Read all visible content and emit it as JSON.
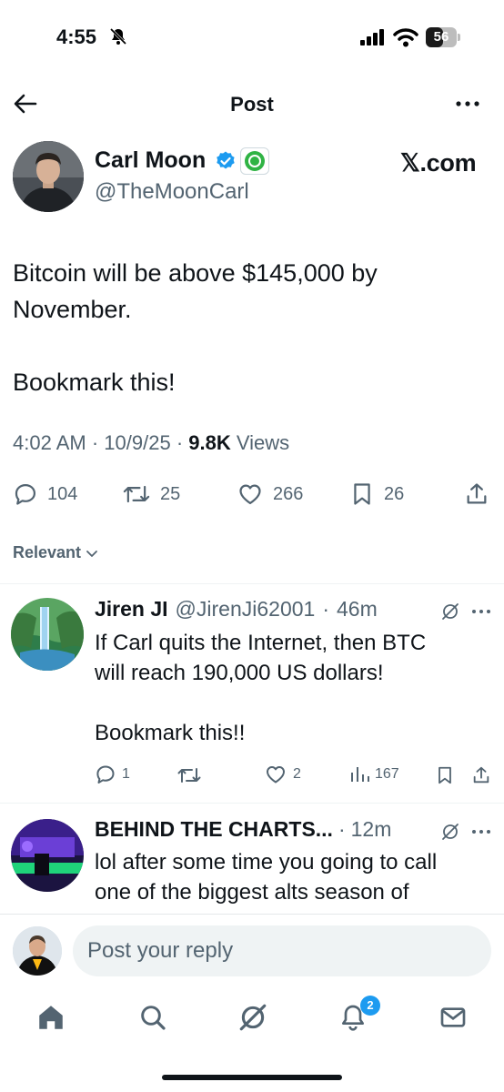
{
  "status_bar": {
    "time": "4:55",
    "battery": "56",
    "battery_level": 0.56
  },
  "header": {
    "title": "Post"
  },
  "post": {
    "display_name": "Carl Moon",
    "handle": "@TheMoonCarl",
    "source": "𝕏.com",
    "text": "Bitcoin will be above $145,000 by\nNovember.\n\nBookmark this!",
    "time": "4:02 AM",
    "date": "10/9/25",
    "views_count": "9.8K",
    "views_label": "Views",
    "replies": "104",
    "reposts": "25",
    "likes": "266",
    "bookmarks": "26"
  },
  "sort": {
    "label": "Relevant"
  },
  "replies": [
    {
      "display_name": "Jiren JI",
      "handle": "@JirenJi62001",
      "time": "46m",
      "text": "If Carl quits the Internet, then BTC\nwill reach 190,000 US dollars!\n\nBookmark this!!",
      "reply_count": "1",
      "like_count": "2",
      "view_count": "167"
    },
    {
      "display_name": "BEHIND THE CHARTS...",
      "time": "12m",
      "text": "lol after some time you going to call\none of the biggest alts season of"
    }
  ],
  "reply_bar": {
    "placeholder": "Post your reply"
  },
  "nav": {
    "notifications_badge": "2"
  },
  "colors": {
    "accent": "#1d9bf0",
    "text": "#0f1419",
    "muted": "#536471"
  }
}
